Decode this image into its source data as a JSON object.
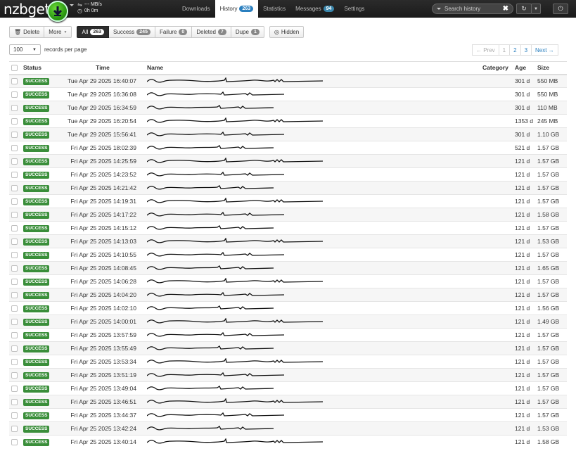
{
  "app": {
    "logo": "nzbget"
  },
  "speed": {
    "rate": "--- MB/s",
    "eta": "0h 0m"
  },
  "nav": [
    {
      "label": "Downloads",
      "active": false
    },
    {
      "label": "History",
      "active": true,
      "badge": "263",
      "badge_color": "#2a7fbf"
    },
    {
      "label": "Statistics",
      "active": false
    },
    {
      "label": "Messages",
      "active": false,
      "badge": "94",
      "badge_color": "#3a87ad"
    },
    {
      "label": "Settings",
      "active": false
    }
  ],
  "search": {
    "placeholder": "Search history"
  },
  "toolbar": {
    "delete_label": "Delete",
    "more_label": "More",
    "filters": [
      {
        "label": "All",
        "count": "263",
        "active": true
      },
      {
        "label": "Success",
        "count": "245",
        "active": false
      },
      {
        "label": "Failure",
        "count": "0",
        "active": false
      },
      {
        "label": "Deleted",
        "count": "7",
        "active": false
      },
      {
        "label": "Dupe",
        "count": "1",
        "active": false
      }
    ],
    "hidden_label": "Hidden"
  },
  "records": {
    "value": "100",
    "label": "records per page"
  },
  "pager": {
    "prev": "← Prev",
    "pages": [
      "1",
      "2",
      "3"
    ],
    "next": "Next →"
  },
  "table": {
    "headers": {
      "status": "Status",
      "time": "Time",
      "name": "Name",
      "category": "Category",
      "age": "Age",
      "size": "Size"
    },
    "rows": [
      {
        "status": "SUCCESS",
        "time": "Tue Apr 29 2025 16:40:07",
        "category": "",
        "age": "301 d",
        "size": "550 MB"
      },
      {
        "status": "SUCCESS",
        "time": "Tue Apr 29 2025 16:36:08",
        "category": "",
        "age": "301 d",
        "size": "550 MB"
      },
      {
        "status": "SUCCESS",
        "time": "Tue Apr 29 2025 16:34:59",
        "category": "",
        "age": "301 d",
        "size": "110 MB"
      },
      {
        "status": "SUCCESS",
        "time": "Tue Apr 29 2025 16:20:54",
        "category": "",
        "age": "1353 d",
        "size": "245 MB"
      },
      {
        "status": "SUCCESS",
        "time": "Tue Apr 29 2025 15:56:41",
        "category": "",
        "age": "301 d",
        "size": "1.10 GB"
      },
      {
        "status": "SUCCESS",
        "time": "Fri Apr 25 2025 18:02:39",
        "category": "",
        "age": "521 d",
        "size": "1.57 GB"
      },
      {
        "status": "SUCCESS",
        "time": "Fri Apr 25 2025 14:25:59",
        "category": "",
        "age": "121 d",
        "size": "1.57 GB"
      },
      {
        "status": "SUCCESS",
        "time": "Fri Apr 25 2025 14:23:52",
        "category": "",
        "age": "121 d",
        "size": "1.57 GB"
      },
      {
        "status": "SUCCESS",
        "time": "Fri Apr 25 2025 14:21:42",
        "category": "",
        "age": "121 d",
        "size": "1.57 GB"
      },
      {
        "status": "SUCCESS",
        "time": "Fri Apr 25 2025 14:19:31",
        "category": "",
        "age": "121 d",
        "size": "1.57 GB"
      },
      {
        "status": "SUCCESS",
        "time": "Fri Apr 25 2025 14:17:22",
        "category": "",
        "age": "121 d",
        "size": "1.58 GB"
      },
      {
        "status": "SUCCESS",
        "time": "Fri Apr 25 2025 14:15:12",
        "category": "",
        "age": "121 d",
        "size": "1.57 GB"
      },
      {
        "status": "SUCCESS",
        "time": "Fri Apr 25 2025 14:13:03",
        "category": "",
        "age": "121 d",
        "size": "1.53 GB"
      },
      {
        "status": "SUCCESS",
        "time": "Fri Apr 25 2025 14:10:55",
        "category": "",
        "age": "121 d",
        "size": "1.57 GB"
      },
      {
        "status": "SUCCESS",
        "time": "Fri Apr 25 2025 14:08:45",
        "category": "",
        "age": "121 d",
        "size": "1.65 GB"
      },
      {
        "status": "SUCCESS",
        "time": "Fri Apr 25 2025 14:06:28",
        "category": "",
        "age": "121 d",
        "size": "1.57 GB"
      },
      {
        "status": "SUCCESS",
        "time": "Fri Apr 25 2025 14:04:20",
        "category": "",
        "age": "121 d",
        "size": "1.57 GB"
      },
      {
        "status": "SUCCESS",
        "time": "Fri Apr 25 2025 14:02:10",
        "category": "",
        "age": "121 d",
        "size": "1.56 GB"
      },
      {
        "status": "SUCCESS",
        "time": "Fri Apr 25 2025 14:00:01",
        "category": "",
        "age": "121 d",
        "size": "1.49 GB"
      },
      {
        "status": "SUCCESS",
        "time": "Fri Apr 25 2025 13:57:59",
        "category": "",
        "age": "121 d",
        "size": "1.57 GB"
      },
      {
        "status": "SUCCESS",
        "time": "Fri Apr 25 2025 13:55:49",
        "category": "",
        "age": "121 d",
        "size": "1.57 GB"
      },
      {
        "status": "SUCCESS",
        "time": "Fri Apr 25 2025 13:53:34",
        "category": "",
        "age": "121 d",
        "size": "1.57 GB"
      },
      {
        "status": "SUCCESS",
        "time": "Fri Apr 25 2025 13:51:19",
        "category": "",
        "age": "121 d",
        "size": "1.57 GB"
      },
      {
        "status": "SUCCESS",
        "time": "Fri Apr 25 2025 13:49:04",
        "category": "",
        "age": "121 d",
        "size": "1.57 GB"
      },
      {
        "status": "SUCCESS",
        "time": "Fri Apr 25 2025 13:46:51",
        "category": "",
        "age": "121 d",
        "size": "1.57 GB"
      },
      {
        "status": "SUCCESS",
        "time": "Fri Apr 25 2025 13:44:37",
        "category": "",
        "age": "121 d",
        "size": "1.57 GB"
      },
      {
        "status": "SUCCESS",
        "time": "Fri Apr 25 2025 13:42:24",
        "category": "",
        "age": "121 d",
        "size": "1.53 GB"
      },
      {
        "status": "SUCCESS",
        "time": "Fri Apr 25 2025 13:40:14",
        "category": "",
        "age": "121 d",
        "size": "1.58 GB"
      }
    ]
  },
  "colors": {
    "success": "#3a8e3a",
    "navbar": "#1b1b1b",
    "link": "#2a7fbf"
  }
}
